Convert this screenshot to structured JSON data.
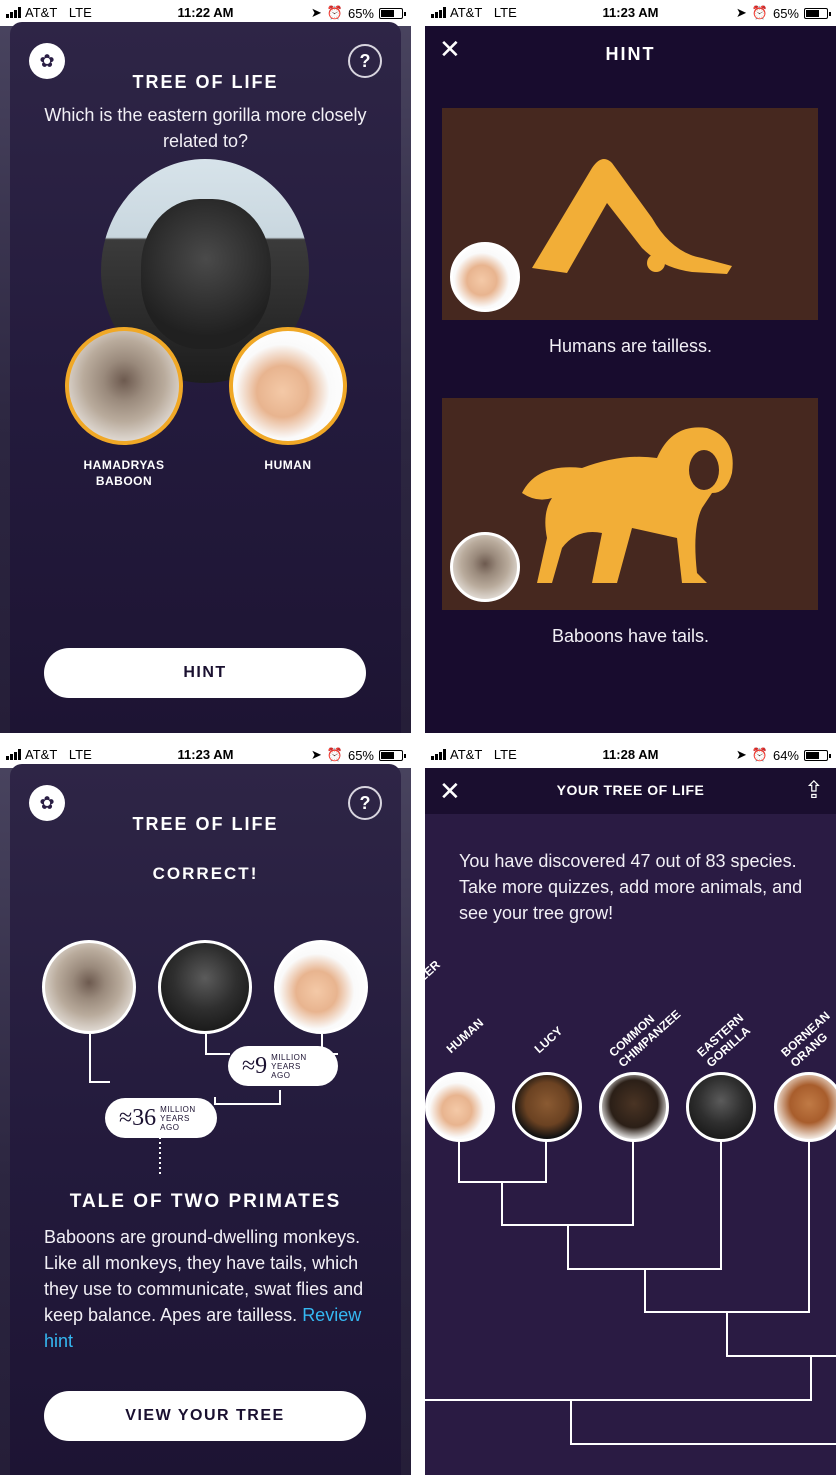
{
  "screens": [
    {
      "status": {
        "carrier": "AT&T",
        "network": "LTE",
        "time": "11:22 AM",
        "battery": "65%"
      },
      "title": "TREE OF LIFE",
      "question": "Which is the eastern gorilla more closely related to?",
      "choices": [
        {
          "label_line1": "HAMADRYAS",
          "label_line2": "BABOON"
        },
        {
          "label_line1": "HUMAN"
        }
      ],
      "help_icon": "?",
      "hint_button": "HINT"
    },
    {
      "status": {
        "carrier": "AT&T",
        "network": "LTE",
        "time": "11:23 AM",
        "battery": "65%"
      },
      "title": "HINT",
      "close_icon": "✕",
      "captions": [
        "Humans are tailless.",
        "Baboons have tails."
      ]
    },
    {
      "status": {
        "carrier": "AT&T",
        "network": "LTE",
        "time": "11:23 AM",
        "battery": "65%"
      },
      "title": "TREE OF LIFE",
      "result": "CORRECT!",
      "help_icon": "?",
      "ages": [
        {
          "num": "≈9",
          "u1": "MILLION",
          "u2": "YEARS",
          "u3": "AGO"
        },
        {
          "num": "≈36",
          "u1": "MILLION",
          "u2": "YEARS",
          "u3": "AGO"
        }
      ],
      "section_title": "TALE OF TWO PRIMATES",
      "body": "Baboons are ground-dwelling monkeys. Like all monkeys, they have tails, which they use to communicate, swat flies and keep balance. Apes are tailless.",
      "link": "Review hint",
      "button": "VIEW YOUR TREE"
    },
    {
      "status": {
        "carrier": "AT&T",
        "network": "LTE",
        "time": "11:28 AM",
        "battery": "64%"
      },
      "title": "YOUR TREE OF LIFE",
      "close_icon": "✕",
      "share_icon": "⇪",
      "intro": "You have discovered 47 out of 83 species. Take more quizzes, add more animals, and see your tree grow!",
      "species": [
        {
          "label": "LER"
        },
        {
          "label": "HUMAN"
        },
        {
          "label": "LUCY"
        },
        {
          "label": "COMMON CHIMPANZEE",
          "l1": "COMMON",
          "l2": "CHIMPANZEE"
        },
        {
          "label": "EASTERN GORILLA",
          "l1": "EASTERN",
          "l2": "GORILLA"
        },
        {
          "label": "BORNEAN ORANGUTAN",
          "l1": "BORNEAN",
          "l2": "ORANG"
        }
      ]
    }
  ]
}
